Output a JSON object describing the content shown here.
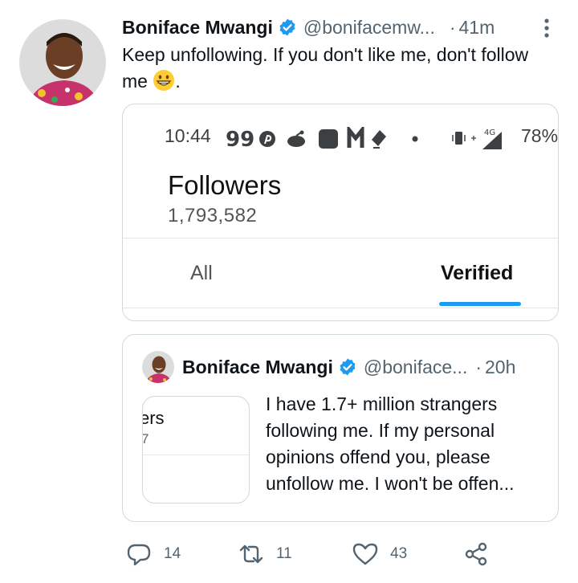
{
  "tweet": {
    "author_name": "Boniface Mwangi",
    "handle": "@bonifacemw...",
    "dot": "·",
    "time": "41m",
    "text": "Keep unfollowing. If you don't like me, don't follow me",
    "text_end": ".",
    "emoji": "grinning-face-emoji",
    "verified": true
  },
  "media": {
    "status_time": "10:44",
    "network": "4G",
    "battery": "78%",
    "title": "Followers",
    "count": "1,793,582",
    "tab_all": "All",
    "tab_verified": "Verified",
    "accent": "#1d9bf0"
  },
  "quote": {
    "author_name": "Boniface Mwangi",
    "handle": "@boniface...",
    "dot": "·",
    "time": "20h",
    "thumb_text1": "ers",
    "thumb_text2": "7",
    "text": "I have 1.7+ million strangers following me. If my personal opinions offend you, please unfollow me. I won't be offen..."
  },
  "actions": {
    "replies": "14",
    "retweets": "11",
    "likes": "43"
  },
  "colors": {
    "text": "#0f1419",
    "secondary": "#536471",
    "border": "#cfd9de",
    "verified": "#1d9bf0"
  }
}
